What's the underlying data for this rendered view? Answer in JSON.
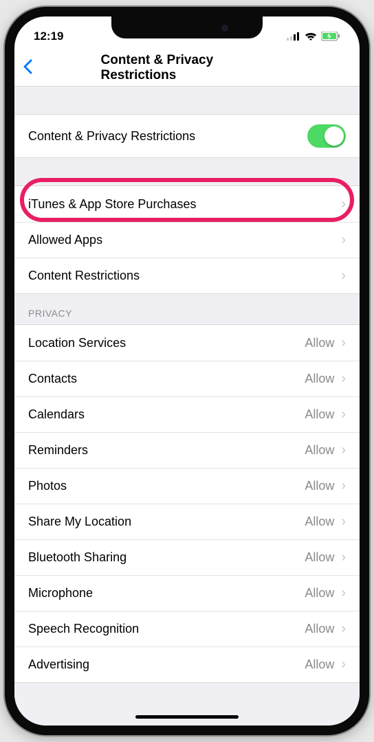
{
  "status": {
    "time": "12:19"
  },
  "nav": {
    "title": "Content & Privacy Restrictions"
  },
  "section1": {
    "toggleRow": {
      "label": "Content & Privacy Restrictions"
    }
  },
  "section2": {
    "items": [
      {
        "label": "iTunes & App Store Purchases"
      },
      {
        "label": "Allowed Apps"
      },
      {
        "label": "Content Restrictions"
      }
    ]
  },
  "section3": {
    "header": "PRIVACY",
    "items": [
      {
        "label": "Location Services",
        "value": "Allow"
      },
      {
        "label": "Contacts",
        "value": "Allow"
      },
      {
        "label": "Calendars",
        "value": "Allow"
      },
      {
        "label": "Reminders",
        "value": "Allow"
      },
      {
        "label": "Photos",
        "value": "Allow"
      },
      {
        "label": "Share My Location",
        "value": "Allow"
      },
      {
        "label": "Bluetooth Sharing",
        "value": "Allow"
      },
      {
        "label": "Microphone",
        "value": "Allow"
      },
      {
        "label": "Speech Recognition",
        "value": "Allow"
      },
      {
        "label": "Advertising",
        "value": "Allow"
      }
    ]
  }
}
